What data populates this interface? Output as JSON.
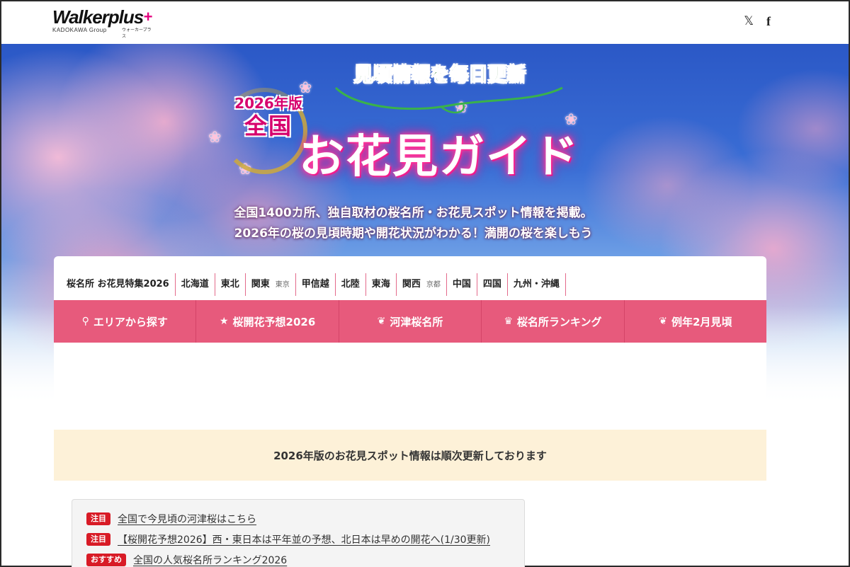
{
  "header": {
    "logo_main": "Walkerplus",
    "logo_plus": "+",
    "logo_group": "KADOKAWA Group",
    "logo_kana": "ウォーカープラス",
    "social": {
      "x": "𝕏",
      "facebook": "f"
    }
  },
  "hero": {
    "catch": "見頃情報を毎日更新",
    "edition_year": "2026年版",
    "edition_scope": "全国",
    "title": "お花見ガイド",
    "lead_line1": "全国1400カ所、独自取材の桜名所・お花見スポット情報を掲載。",
    "lead_line2": "2026年の桜の見頃時期や開花状況がわかる！満開の桜を楽しもう"
  },
  "region_nav": [
    {
      "label": "桜名所 お花見特集2026"
    },
    {
      "label": "北海道"
    },
    {
      "label": "東北"
    },
    {
      "label": "関東",
      "sub": "東京"
    },
    {
      "label": "甲信越"
    },
    {
      "label": "北陸"
    },
    {
      "label": "東海"
    },
    {
      "label": "関西",
      "sub": "京都"
    },
    {
      "label": "中国"
    },
    {
      "label": "四国"
    },
    {
      "label": "九州・沖縄"
    }
  ],
  "menu": [
    {
      "icon": "pin-icon",
      "glyph": "⚲",
      "label": "エリアから探す"
    },
    {
      "icon": "star-icon",
      "glyph": "★",
      "label": "桜開花予想2026"
    },
    {
      "icon": "leaf-icon",
      "glyph": "❦",
      "label": "河津桜名所"
    },
    {
      "icon": "crown-icon",
      "glyph": "♛",
      "label": "桜名所ランキング"
    },
    {
      "icon": "leaf-icon",
      "glyph": "❦",
      "label": "例年2月見頃"
    }
  ],
  "notice": "2026年版のお花見スポット情報は順次更新しております",
  "news": [
    {
      "tag": "注目",
      "text": "全国で今見頃の河津桜はこちら"
    },
    {
      "tag": "注目",
      "text": "【桜開花予想2026】西・東日本は平年並の予想、北日本は早めの開花へ(1/30更新)"
    },
    {
      "tag": "おすすめ",
      "text": "全国の人気桜名所ランキング2026"
    }
  ],
  "colors": {
    "accent": "#e75a7c",
    "tag": "#d81b26",
    "notice_bg": "#fdf1d8",
    "title_glow": "#e4007f"
  }
}
